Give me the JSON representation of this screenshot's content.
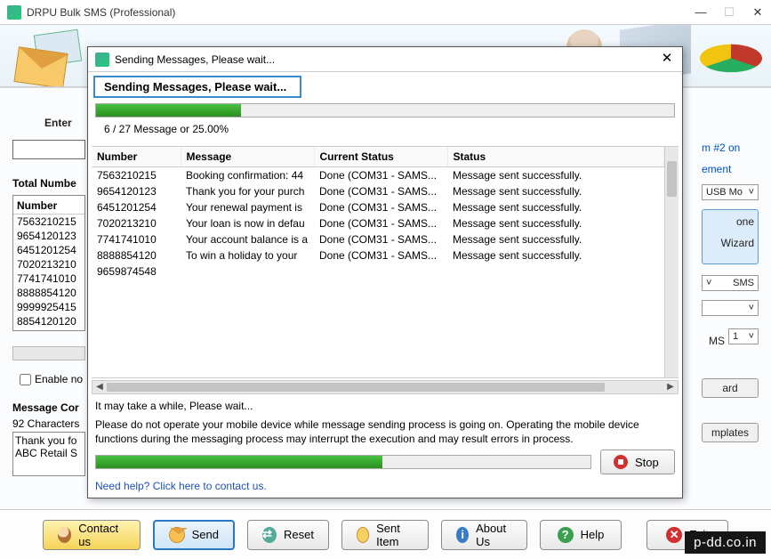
{
  "window": {
    "title": "DRPU Bulk SMS (Professional)"
  },
  "header": {},
  "bg": {
    "enter_label": "Enter",
    "total_label": "Total Numbe",
    "number_header": "Number",
    "numbers": [
      "7563210215",
      "9654120123",
      "6451201254",
      "7020213210",
      "7741741010",
      "8888854120",
      "9999925415",
      "8854120120"
    ],
    "enable_label": "Enable no",
    "msgcomp_label": "Message Cor",
    "chars_label": "92 Characters",
    "msg_text": "Thank you fo ABC Retail S"
  },
  "right": {
    "item2": "m #2 on",
    "mgmt": "ement",
    "sel1": "USB Mo",
    "box1": "one",
    "box2": "Wizard",
    "sms": "SMS",
    "sms2": "MS",
    "one": "1",
    "ard": "ard",
    "tmpl": "mplates"
  },
  "buttons": {
    "contact": "Contact us",
    "send": "Send",
    "reset": "Reset",
    "sent": "Sent Item",
    "about": "About Us",
    "help": "Help",
    "exit": "Exit"
  },
  "modal": {
    "title": "Sending Messages, Please wait...",
    "subtitle": "Sending Messages, Please wait...",
    "progress_text": "6 / 27 Message or 25.00%",
    "columns": {
      "c1": "Number",
      "c2": "Message",
      "c3": "Current Status",
      "c4": "Status"
    },
    "rows": [
      {
        "n": "7563210215",
        "m": "Booking confirmation: 44",
        "c": "Done (COM31 - SAMS...",
        "s": "Message sent successfully."
      },
      {
        "n": "9654120123",
        "m": "Thank you for your purch",
        "c": "Done (COM31 - SAMS...",
        "s": "Message sent successfully."
      },
      {
        "n": "6451201254",
        "m": "Your renewal payment is",
        "c": "Done (COM31 - SAMS...",
        "s": "Message sent successfully."
      },
      {
        "n": "7020213210",
        "m": "Your loan is now in defau",
        "c": "Done (COM31 - SAMS...",
        "s": "Message sent successfully."
      },
      {
        "n": "7741741010",
        "m": "Your account balance is a",
        "c": "Done (COM31 - SAMS...",
        "s": "Message sent successfully."
      },
      {
        "n": "8888854120",
        "m": "To win a holiday to your",
        "c": "Done (COM31 - SAMS...",
        "s": "Message sent successfully."
      },
      {
        "n": "9659874548",
        "m": "",
        "c": "",
        "s": ""
      }
    ],
    "wait": "It may take a while, Please wait...",
    "warn": "Please do not operate your mobile device while message sending process is going on. Operating the mobile device functions during the messaging process may interrupt the execution and may result errors in process.",
    "stop": "Stop",
    "help": "Need help? Click here to contact us."
  },
  "watermark": "p-dd.co.in"
}
